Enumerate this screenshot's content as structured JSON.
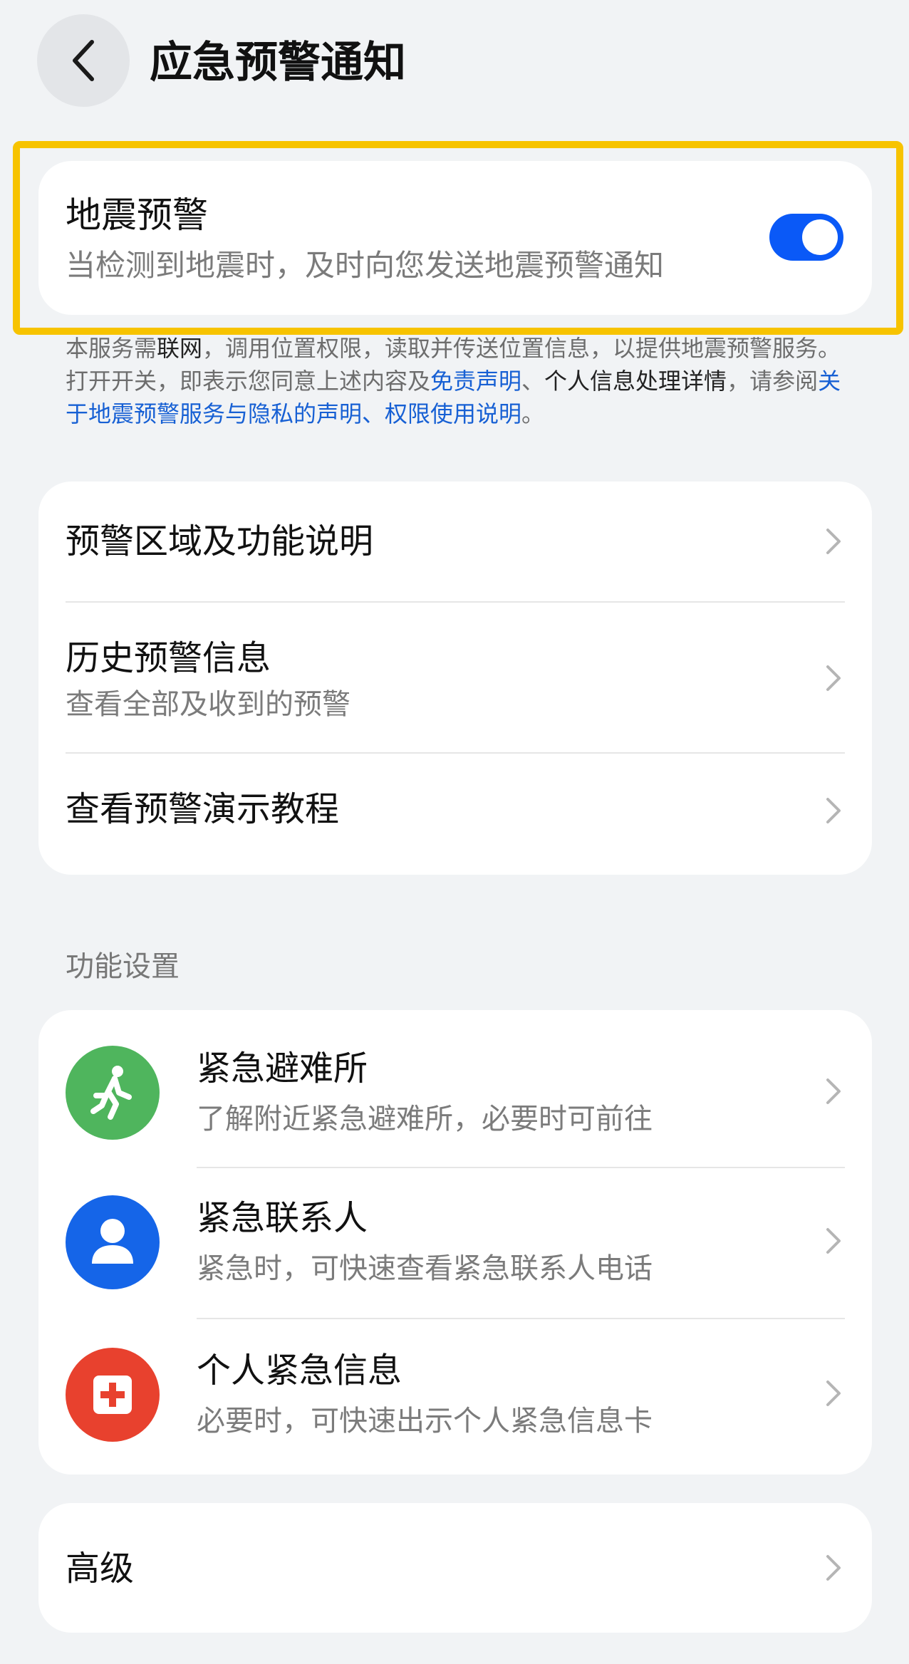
{
  "header": {
    "title": "应急预警通知"
  },
  "earthquake": {
    "title": "地震预警",
    "subtitle": "当检测到地震时，及时向您发送地震预警通知",
    "enabled": true
  },
  "notice": {
    "part1": "本服务需",
    "part1_bold": "联网",
    "part2": "，调用位置权限，读取并传送位置信息，以提供地震预警服务。打开开关，即表示您同意上述内容及",
    "link1": "免责声明",
    "sep1": "、",
    "link2": "个人信息处理详情",
    "part3": "，请参阅",
    "link3": "关于地震预警服务与隐私的声明",
    "sep2": "、",
    "link4": "权限使用说明",
    "end": "。"
  },
  "info_list": [
    {
      "title": "预警区域及功能说明"
    },
    {
      "title": "历史预警信息",
      "subtitle": "查看全部及收到的预警"
    },
    {
      "title": "查看预警演示教程"
    }
  ],
  "section": {
    "label": "功能设置"
  },
  "feature_list": [
    {
      "title": "紧急避难所",
      "subtitle": "了解附近紧急避难所，必要时可前往",
      "icon": "running-person-icon",
      "color": "#4fb55d"
    },
    {
      "title": "紧急联系人",
      "subtitle": "紧急时，可快速查看紧急联系人电话",
      "icon": "person-icon",
      "color": "#1565e8"
    },
    {
      "title": "个人紧急信息",
      "subtitle": "必要时，可快速出示个人紧急信息卡",
      "icon": "medical-cross-icon",
      "color": "#e8412e"
    }
  ],
  "advanced": {
    "title": "高级"
  },
  "colors": {
    "accent": "#0a59f7",
    "highlight": "#f7c300",
    "link": "#1760d4",
    "background": "#f1f3f5"
  }
}
